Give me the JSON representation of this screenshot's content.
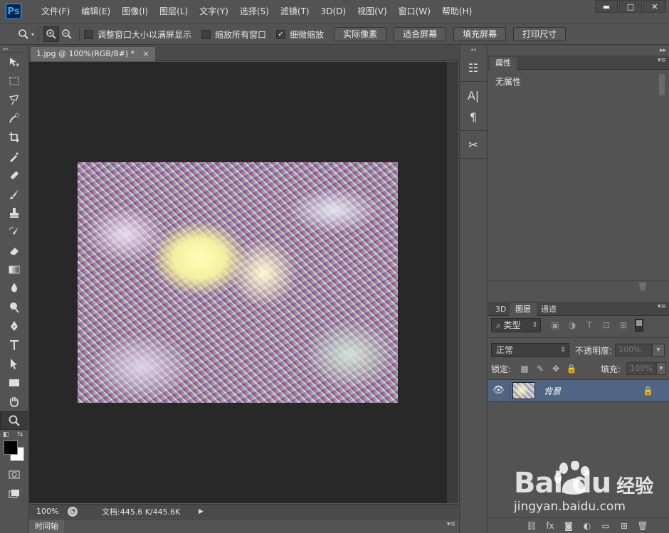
{
  "app": {
    "logo": "Ps",
    "menus": [
      "文件(F)",
      "编辑(E)",
      "图像(I)",
      "图层(L)",
      "文字(Y)",
      "选择(S)",
      "滤镜(T)",
      "3D(D)",
      "视图(V)",
      "窗口(W)",
      "帮助(H)"
    ],
    "window_controls": [
      "minimize-icon",
      "maximize-icon",
      "close-icon"
    ]
  },
  "options": {
    "checkboxes": [
      {
        "label": "调整窗口大小以满屏显示",
        "checked": false
      },
      {
        "label": "缩放所有窗口",
        "checked": false
      },
      {
        "label": "细微缩放",
        "checked": true
      }
    ],
    "buttons": [
      "实际像素",
      "适合屏幕",
      "填充屏幕",
      "打印尺寸"
    ]
  },
  "document": {
    "tab_title": "1.jpg @ 100%(RGB/8#) *",
    "tab_close": "×",
    "zoom": "100%",
    "doc_size": "文档:445.6 K/445.6K"
  },
  "timeline": {
    "label": "时间轴"
  },
  "properties": {
    "tab": "属性",
    "text": "无属性"
  },
  "layers": {
    "tabs": [
      "3D",
      "图层",
      "通道"
    ],
    "filter_kind": "类型",
    "blend_mode": "正常",
    "opacity_label": "不透明度:",
    "opacity_value": "100%",
    "lock_label": "锁定:",
    "fill_label": "填充:",
    "fill_value": "100%",
    "layer_name": "背景"
  },
  "watermark": {
    "brand": "Bai du",
    "brand_cn": "经验",
    "url": "jingyan.baidu.com"
  },
  "colors": {
    "accent_ps": "#31a8ff",
    "selected_layer": "#4f6582",
    "canvas_bg": "#282828",
    "ui_bg": "#535353"
  }
}
